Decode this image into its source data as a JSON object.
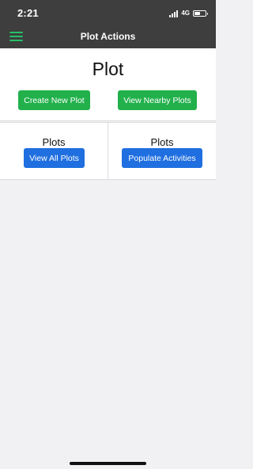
{
  "status_bar": {
    "time": "2:21",
    "network": "4G",
    "battery_level": 0.55
  },
  "nav": {
    "title": "Plot Actions",
    "menu_icon": "hamburger-menu-icon"
  },
  "plot_section": {
    "heading": "Plot",
    "create_label": "Create New Plot",
    "nearby_label": "View Nearby Plots"
  },
  "plots_left": {
    "title": "Plots",
    "button_label": "View All Plots"
  },
  "plots_right": {
    "title": "Plots",
    "button_label": "Populate Activities"
  },
  "colors": {
    "green_button": "#22b04b",
    "blue_button": "#1f6fe0",
    "menu_icon": "#27c06a",
    "header_bg": "#3d3e3d"
  }
}
